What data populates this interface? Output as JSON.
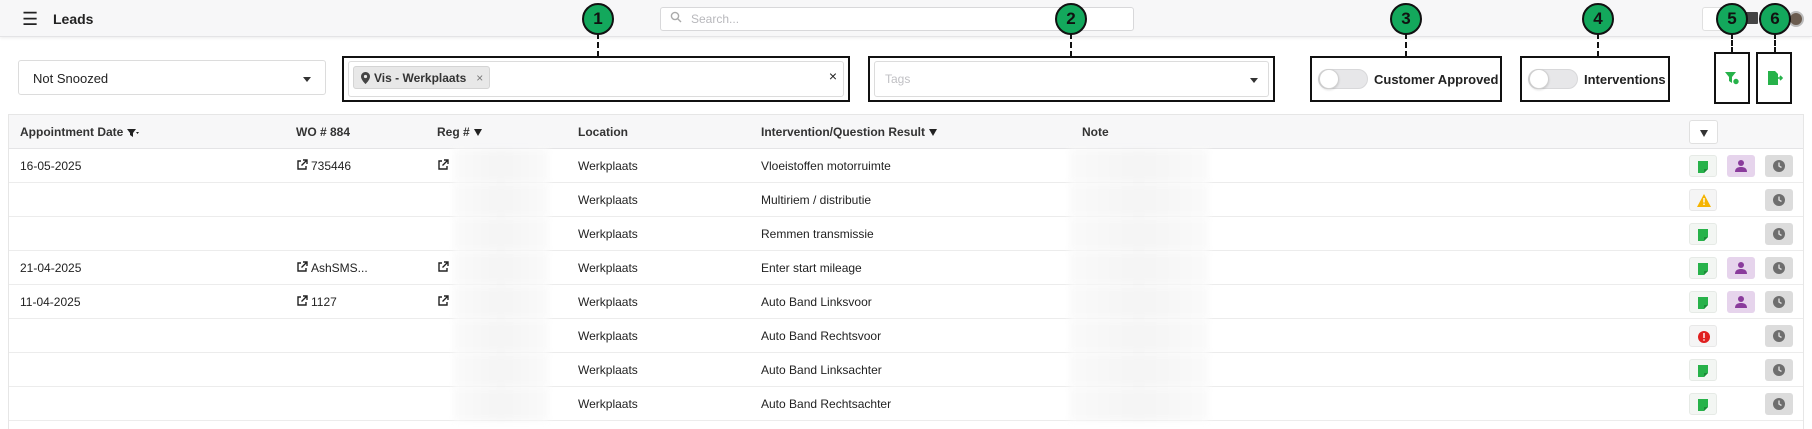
{
  "header": {
    "menu_icon": "hamburger-icon",
    "title": "Leads",
    "search_placeholder": "Search..."
  },
  "filters": {
    "snooze_dropdown": {
      "selected": "Not Snoozed"
    },
    "location_chip": "Vis - Werkplaats",
    "location_chip_remove": "×",
    "location_clear": "×",
    "tags_placeholder": "Tags",
    "customer_approved_label": "Customer Approved",
    "interventions_label": "Interventions"
  },
  "markers": [
    "1",
    "2",
    "3",
    "4",
    "5",
    "6"
  ],
  "table": {
    "headers": {
      "appointment_date": "Appointment Date",
      "wo": "WO # 884",
      "reg": "Reg #",
      "location": "Location",
      "intervention": "Intervention/Question Result",
      "note": "Note"
    },
    "rows": [
      {
        "date": "16-05-2025",
        "wo": "735446",
        "location": "Werkplaats",
        "result": "Vloeistoffen motorruimte",
        "actions": [
          "note",
          "person",
          "clock"
        ]
      },
      {
        "date": "",
        "wo": "",
        "location": "Werkplaats",
        "result": "Multiriem / distributie",
        "actions": [
          "warning",
          "clock"
        ]
      },
      {
        "date": "",
        "wo": "",
        "location": "Werkplaats",
        "result": "Remmen transmissie",
        "actions": [
          "note",
          "clock"
        ]
      },
      {
        "date": "21-04-2025",
        "wo": "AshSMS...",
        "location": "Werkplaats",
        "result": "Enter start mileage",
        "actions": [
          "note",
          "person",
          "clock"
        ]
      },
      {
        "date": "11-04-2025",
        "wo": "1127",
        "location": "Werkplaats",
        "result": "Auto Band Linksvoor",
        "actions": [
          "note",
          "person",
          "clock"
        ]
      },
      {
        "date": "",
        "wo": "",
        "location": "Werkplaats",
        "result": "Auto Band Rechtsvoor",
        "actions": [
          "error",
          "clock"
        ]
      },
      {
        "date": "",
        "wo": "",
        "location": "Werkplaats",
        "result": "Auto Band Linksachter",
        "actions": [
          "note",
          "clock"
        ]
      },
      {
        "date": "",
        "wo": "",
        "location": "Werkplaats",
        "result": "Auto Band Rechtsachter",
        "actions": [
          "note",
          "clock"
        ]
      }
    ]
  },
  "colors": {
    "marker": "#13a85c",
    "note_icon": "#27b24a",
    "person_icon": "#8a3b9c",
    "warning_icon": "#f5b400",
    "error_icon": "#e02020"
  }
}
